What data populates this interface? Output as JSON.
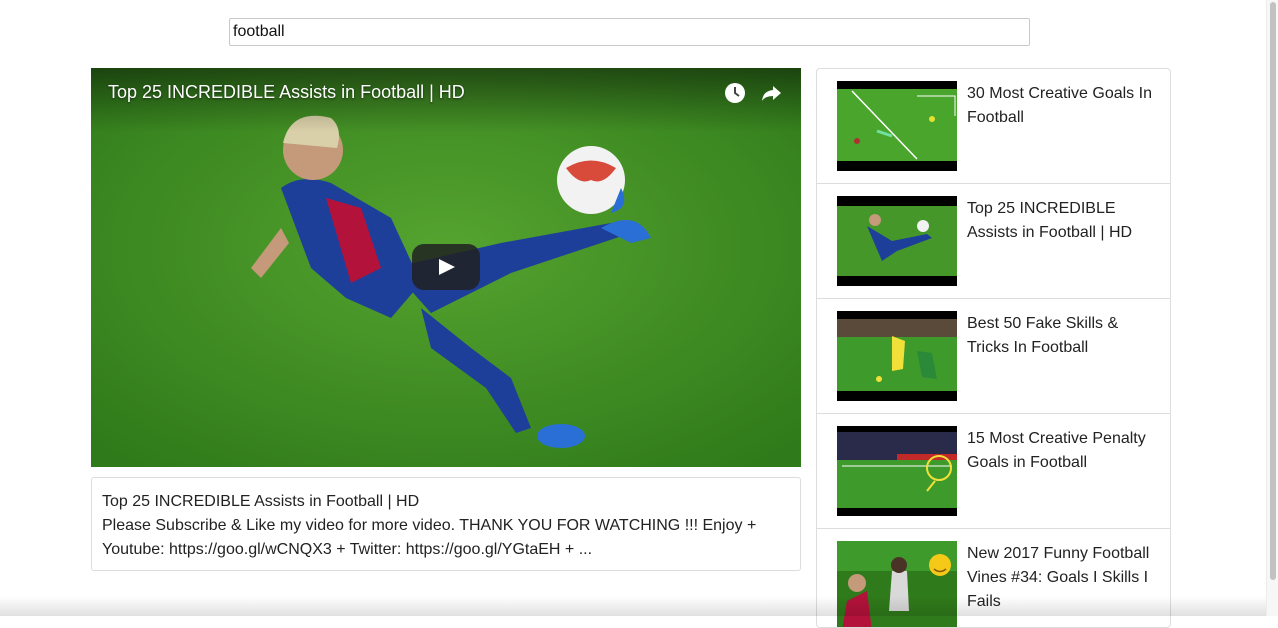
{
  "search": {
    "value": "football"
  },
  "player": {
    "title": "Top 25 INCREDIBLE Assists in Football | HD",
    "watch_later_icon": "clock-icon",
    "share_icon": "share-arrow-icon",
    "play_icon": "play-icon"
  },
  "details": {
    "title": "Top 25 INCREDIBLE Assists in Football | HD",
    "description": "Please Subscribe & Like my video for more video. THANK YOU FOR WATCHING !!! Enjoy + Youtube: https://goo.gl/wCNQX3 + Twitter: https://goo.gl/YGtaEH + ..."
  },
  "videos": [
    {
      "title": "30 Most Creative Goals In Football"
    },
    {
      "title": "Top 25 INCREDIBLE Assists in Football | HD"
    },
    {
      "title": "Best 50 Fake Skills & Tricks In Football"
    },
    {
      "title": "15 Most Creative Penalty Goals in Football"
    },
    {
      "title": "New 2017 Funny Football Vines #34: Goals I Skills I Fails"
    }
  ],
  "colors": {
    "pitch": "#3f8f25",
    "border": "#dddddd",
    "play_button": "#212121"
  }
}
